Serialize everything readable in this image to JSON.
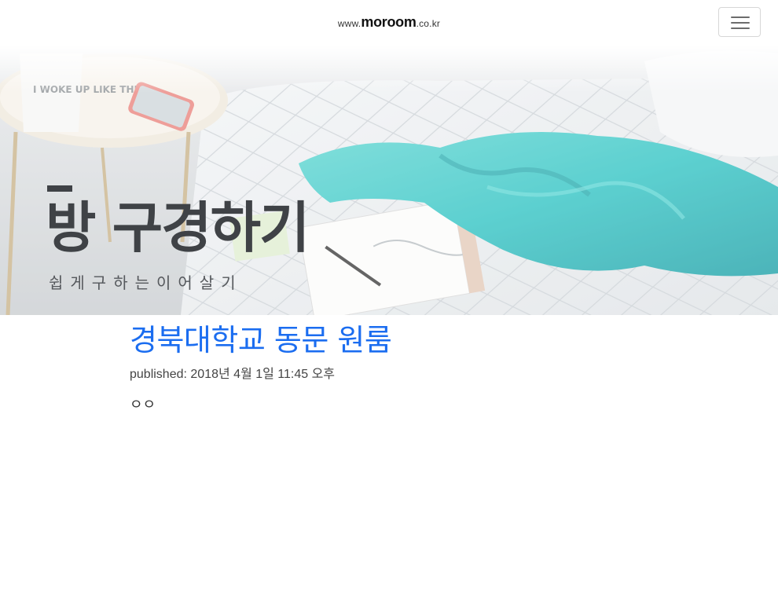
{
  "navbar": {
    "brand_prefix": "www.",
    "brand_name": "moroom",
    "brand_suffix": ".co.kr",
    "menu_button_icon": "hamburger-icon"
  },
  "hero": {
    "title": "방 구경하기",
    "subtitle": "쉽게구하는이어살기",
    "mug_text": "I WOKE UP LIKE THIS"
  },
  "post": {
    "title": "경북대학교 동문 원룸",
    "published_label": "published:",
    "published_date": "2018년 4월 1일 11:45 오후",
    "body": "ㅇㅇ"
  },
  "colors": {
    "link": "#1b6df0",
    "hero_text": "#3f4246",
    "teal_blanket": "#2fc3c3"
  }
}
